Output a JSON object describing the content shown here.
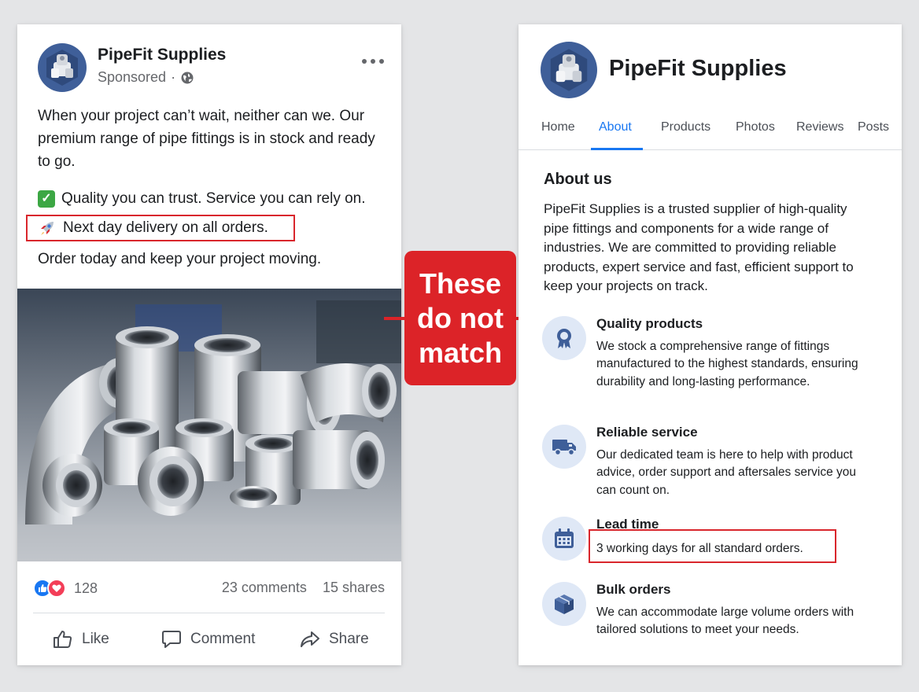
{
  "ad_post": {
    "page_name": "PipeFit Supplies",
    "sponsored_label": "Sponsored",
    "sponsored_separator": "·",
    "body": "When your project can’t wait, neither can we. Our premium range of pipe fittings is in stock and ready to go.",
    "quality_line": "Quality you can trust. Service you can rely on.",
    "delivery_line": "Next day delivery on all orders.",
    "order_line": "Order today and keep your project moving.",
    "reaction_count": "128",
    "comments": "23 comments",
    "shares": "15 shares",
    "actions": {
      "like": "Like",
      "comment": "Comment",
      "share": "Share"
    }
  },
  "callout": {
    "lines": [
      "These",
      "do not",
      "match"
    ]
  },
  "about_page": {
    "page_name": "PipeFit Supplies",
    "tabs": [
      "Home",
      "About",
      "Products",
      "Photos",
      "Reviews",
      "Posts"
    ],
    "active_tab": "About",
    "heading": "About us",
    "description": "PipeFit Supplies is a trusted supplier of high-quality pipe fittings and components for a wide range of industries. We are committed to providing reliable products, expert service and fast, efficient support to keep your projects on track.",
    "features": [
      {
        "title": "Quality products",
        "text": "We stock a comprehensive range of fittings manufactured to the highest standards, ensuring durability and long-lasting performance.",
        "icon": "award-ribbon-icon"
      },
      {
        "title": "Reliable service",
        "text": "Our dedicated team is here to help with product advice, order support and aftersales service you can count on.",
        "icon": "delivery-truck-icon"
      },
      {
        "title": "Lead time",
        "text": "3 working days for all standard orders.",
        "icon": "calendar-icon"
      },
      {
        "title": "Bulk orders",
        "text": "We can accommodate large volume orders with tailored solutions to meet your needs.",
        "icon": "box-icon"
      }
    ]
  },
  "colors": {
    "facebook_blue": "#1877f2",
    "highlight_red": "#d9262c",
    "callout_red": "#dc2328",
    "logo_blue": "#3f5f99"
  }
}
